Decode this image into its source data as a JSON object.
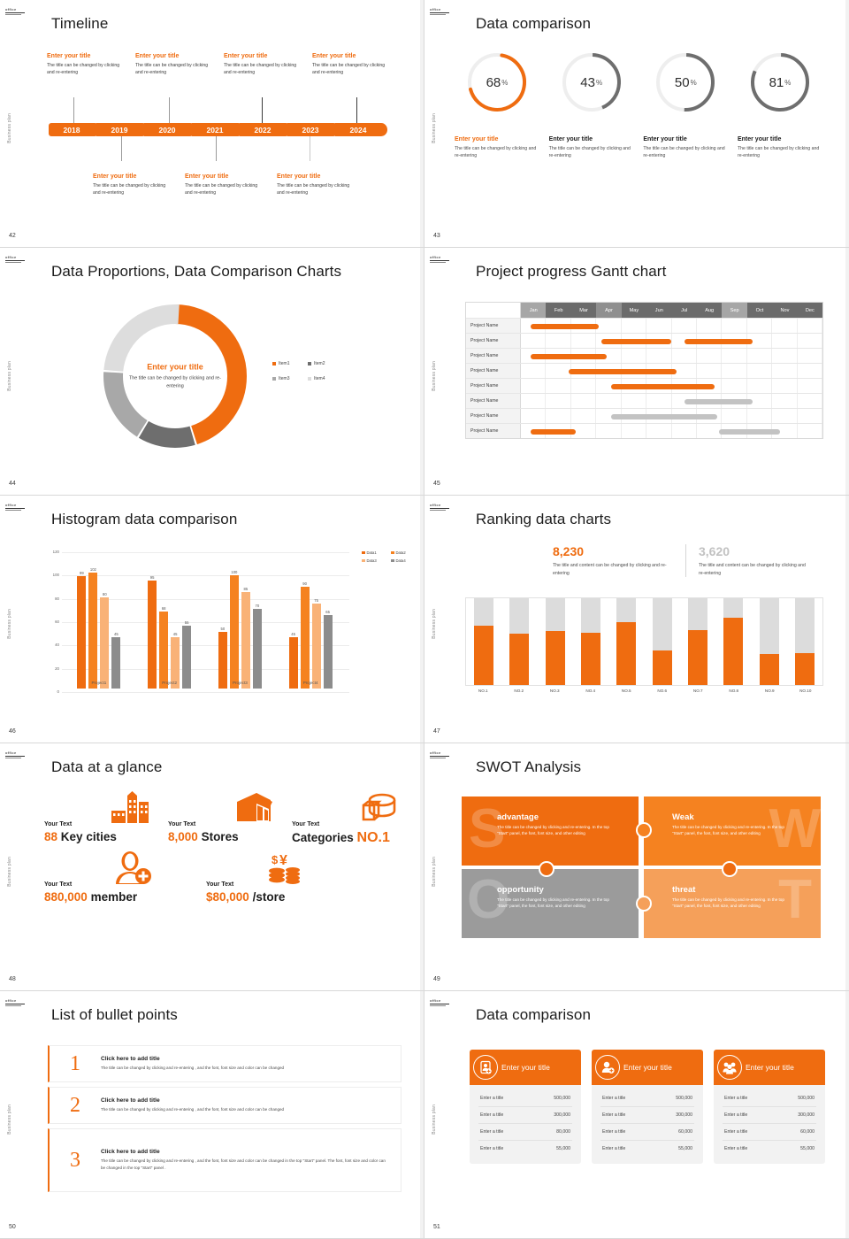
{
  "brand": {
    "accent": "#ef6c10",
    "accent_light": "#f59a4b",
    "accent_lighter": "#f7b884",
    "gray": "#9b9b9b",
    "gray_light": "#d8d8d8"
  },
  "common": {
    "side_label": "Business plan",
    "logo_text": "office"
  },
  "slides": [
    {
      "page": "42",
      "title": "Timeline",
      "years": [
        "2018",
        "2019",
        "2020",
        "2021",
        "2022",
        "2023",
        "2024"
      ],
      "top_items": [
        {
          "title": "Enter your title",
          "text": "The title can be changed by clicking and re-entering"
        },
        {
          "title": "Enter your title",
          "text": "The title can be changed by clicking and re-entering"
        },
        {
          "title": "Enter your title",
          "text": "The title can be changed by clicking and re-entering"
        },
        {
          "title": "Enter your title",
          "text": "The title can be changed by clicking and re-entering"
        }
      ],
      "bottom_items": [
        {
          "title": "Enter your title",
          "text": "The title can be changed by clicking and re-entering"
        },
        {
          "title": "Enter your title",
          "text": "The title can be changed by clicking and re-entering"
        },
        {
          "title": "Enter your title",
          "text": "The title can be changed by clicking and re-entering"
        }
      ]
    },
    {
      "page": "43",
      "title": "Data comparison",
      "chart_data": {
        "type": "pie",
        "title": "Data comparison",
        "categories": [
          "68%",
          "43%",
          "50%",
          "81%"
        ],
        "values": [
          68,
          43,
          50,
          81
        ],
        "colors": [
          "#ef6c10",
          "#6e6e6e",
          "#6e6e6e",
          "#6e6e6e"
        ],
        "track_color": "#eeeeee"
      },
      "rings": [
        {
          "value": "68",
          "unit": "%",
          "pct": 68,
          "color": "#ef6c10",
          "title": "Enter your title",
          "text": "The title can be changed by clicking and re-entering",
          "highlight": true
        },
        {
          "value": "43",
          "unit": "%",
          "pct": 43,
          "color": "#6e6e6e",
          "title": "Enter your title",
          "text": "The title can be changed by clicking and re-entering",
          "highlight": false
        },
        {
          "value": "50",
          "unit": "%",
          "pct": 50,
          "color": "#6e6e6e",
          "title": "Enter your title",
          "text": "The title can be changed by clicking and re-entering",
          "highlight": false
        },
        {
          "value": "81",
          "unit": "%",
          "pct": 81,
          "color": "#6e6e6e",
          "title": "Enter your title",
          "text": "The title can be changed by clicking and re-entering",
          "highlight": false
        }
      ]
    },
    {
      "page": "44",
      "title": "Data Proportions, Data Comparison Charts",
      "center_title": "Enter your title",
      "center_text": "The title can be changed by clicking and re-entering",
      "chart_data": {
        "type": "pie",
        "title": "Data Proportions, Data Comparison Charts",
        "categories": [
          "Item1",
          "Item2",
          "Item3",
          "Item4"
        ],
        "values": [
          45,
          13,
          17,
          25
        ],
        "colors": [
          "#ef6c10",
          "#6e6e6e",
          "#a8a8a8",
          "#dddddd"
        ],
        "legend": "right",
        "donut": true
      },
      "legend": [
        {
          "label": "Item1",
          "color": "#ef6c10"
        },
        {
          "label": "Item2",
          "color": "#6e6e6e"
        },
        {
          "label": "Item3",
          "color": "#a8a8a8"
        },
        {
          "label": "Item4",
          "color": "#dddddd"
        }
      ]
    },
    {
      "page": "45",
      "title": "Project progress Gantt chart",
      "chart_data": {
        "type": "bar",
        "title": "Project progress Gantt chart",
        "months": [
          "Jan",
          "Feb",
          "Mar",
          "Apr",
          "May",
          "Jun",
          "Jul",
          "Aug",
          "Sep",
          "Oct",
          "Nov",
          "Dec"
        ],
        "rows": [
          {
            "name": "Project Name",
            "bars": [
              {
                "start": 0.4,
                "end": 3.1,
                "color": "#ef6c10"
              }
            ]
          },
          {
            "name": "Project Name",
            "bars": [
              {
                "start": 3.2,
                "end": 6.0,
                "color": "#ef6c10"
              },
              {
                "start": 6.5,
                "end": 9.2,
                "color": "#ef6c10"
              }
            ]
          },
          {
            "name": "Project Name",
            "bars": [
              {
                "start": 0.4,
                "end": 3.4,
                "color": "#ef6c10"
              }
            ]
          },
          {
            "name": "Project Name",
            "bars": [
              {
                "start": 1.9,
                "end": 6.2,
                "color": "#ef6c10"
              }
            ]
          },
          {
            "name": "Project Name",
            "bars": [
              {
                "start": 3.6,
                "end": 7.7,
                "color": "#ef6c10"
              }
            ]
          },
          {
            "name": "Project Name",
            "bars": [
              {
                "start": 6.5,
                "end": 9.2,
                "color": "#c3c3c3"
              }
            ]
          },
          {
            "name": "Project Name",
            "bars": [
              {
                "start": 3.6,
                "end": 7.8,
                "color": "#c3c3c3"
              }
            ]
          },
          {
            "name": "Project Name",
            "bars": [
              {
                "start": 0.4,
                "end": 2.2,
                "color": "#ef6c10"
              },
              {
                "start": 7.9,
                "end": 10.3,
                "color": "#c3c3c3"
              }
            ]
          }
        ]
      }
    },
    {
      "page": "46",
      "title": "Histogram data comparison",
      "chart_data": {
        "type": "bar",
        "title": "Histogram data comparison",
        "categories": [
          "Project1",
          "Project2",
          "Project3",
          "Project4"
        ],
        "series": [
          {
            "name": "Data1",
            "color": "#ef6c10",
            "values": [
              99,
              95,
              50,
              45
            ]
          },
          {
            "name": "Data2",
            "color": "#f58220",
            "values": [
              102,
              68,
              100,
              90
            ]
          },
          {
            "name": "Data3",
            "color": "#f9b277",
            "values": [
              80,
              45,
              85,
              75
            ]
          },
          {
            "name": "Data4",
            "color": "#8c8c8c",
            "values": [
              45,
              55,
              70,
              65
            ]
          }
        ],
        "ylim": [
          0,
          120
        ],
        "yticks": [
          0,
          20,
          40,
          60,
          80,
          100,
          120
        ],
        "xlabel": "",
        "ylabel": "",
        "legend": "right",
        "grid": true
      }
    },
    {
      "page": "47",
      "title": "Ranking data charts",
      "stats": [
        {
          "number": "8,230",
          "color": "#ef6c10",
          "text": "The title and content can be changed by clicking and re-entering"
        },
        {
          "number": "3,620",
          "color": "#c2c2c2",
          "text": "The title and content can be changed by clicking and re-entering"
        }
      ],
      "chart_data": {
        "type": "bar",
        "title": "Ranking data charts",
        "categories": [
          "NO.1",
          "NO.2",
          "NO.3",
          "NO.4",
          "NO.5",
          "NO.6",
          "NO.7",
          "NO.8",
          "NO.9",
          "NO.10"
        ],
        "values": [
          68,
          59,
          62,
          60,
          72,
          40,
          63,
          78,
          36,
          37
        ],
        "ylim": [
          0,
          100
        ],
        "bar_color": "#ef6c10",
        "track_color": "#dcdcdc"
      }
    },
    {
      "page": "48",
      "title": "Data at a glance",
      "items": [
        {
          "label": "Your Text",
          "value": "88",
          "suffix": "Key cities",
          "icon": "city-buildings-icon",
          "value_first": true
        },
        {
          "label": "Your Text",
          "value": "8,000",
          "suffix": "Stores",
          "icon": "store-icon",
          "value_first": true
        },
        {
          "label": "Your Text",
          "value": "NO.1",
          "suffix": "Categories",
          "icon": "pie-cylinder-icon",
          "value_first": false
        },
        {
          "label": "Your Text",
          "value": "880,000",
          "suffix": "member",
          "icon": "user-add-icon",
          "value_first": true
        },
        {
          "label": "Your Text",
          "value": "$80,000",
          "suffix": "/store",
          "icon": "coins-yen-icon",
          "value_first": true
        }
      ]
    },
    {
      "page": "49",
      "title": "SWOT Analysis",
      "quadrants": [
        {
          "letter": "S",
          "heading": "advantage",
          "text": "The title can be changed by clicking and re-entering. In the top \"Start\" panel, the font, font size, and other editing",
          "bg": "#ef6c10"
        },
        {
          "letter": "W",
          "heading": "Weak",
          "text": "The title can be changed by clicking and re-entering. In the top \"Start\" panel, the font, font size, and other editing",
          "bg": "#f58220"
        },
        {
          "letter": "O",
          "heading": "opportunity",
          "text": "The title can be changed by clicking and re-entering. In the top \"Start\" panel, the font, font size, and other editing",
          "bg": "#9b9b9b"
        },
        {
          "letter": "T",
          "heading": "threat",
          "text": "The title can be changed by clicking and re-entering. In the top \"Start\" panel, the font, font size, and other editing",
          "bg": "#f5a05a"
        }
      ]
    },
    {
      "page": "50",
      "title": "List of bullet points",
      "rows": [
        {
          "num": "1",
          "title": "Click here to add title",
          "text": "The title can be changed by clicking and re-entering , and the font, font size and color can be changed"
        },
        {
          "num": "2",
          "title": "Click here to add title",
          "text": "The title can be changed by clicking and re-entering , and the font, font size and color can be changed"
        },
        {
          "num": "3",
          "title": "Click here to add title",
          "text": "The title can be changed by clicking and re-entering , and the font, font size and color can be changed in the top \"Start\" panel. The font, font size and color can be changed in the top \"Start\" panel ."
        }
      ]
    },
    {
      "page": "51",
      "title": "Data comparison",
      "cards": [
        {
          "header": "Enter your title",
          "icon": "id-card-add-icon",
          "rows": [
            {
              "label": "Enter a title",
              "value": "500,000"
            },
            {
              "label": "Enter a title",
              "value": "300,000"
            },
            {
              "label": "Enter a title",
              "value": "80,000"
            },
            {
              "label": "Enter a title",
              "value": "55,000"
            }
          ]
        },
        {
          "header": "Enter your title",
          "icon": "user-add-icon",
          "rows": [
            {
              "label": "Enter a title",
              "value": "500,000"
            },
            {
              "label": "Enter a title",
              "value": "300,000"
            },
            {
              "label": "Enter a title",
              "value": "60,000"
            },
            {
              "label": "Enter a title",
              "value": "55,000"
            }
          ]
        },
        {
          "header": "Enter your title",
          "icon": "users-group-icon",
          "rows": [
            {
              "label": "Enter a title",
              "value": "500,000"
            },
            {
              "label": "Enter a title",
              "value": "300,000"
            },
            {
              "label": "Enter a title",
              "value": "60,000"
            },
            {
              "label": "Enter a title",
              "value": "55,000"
            }
          ]
        }
      ]
    }
  ]
}
